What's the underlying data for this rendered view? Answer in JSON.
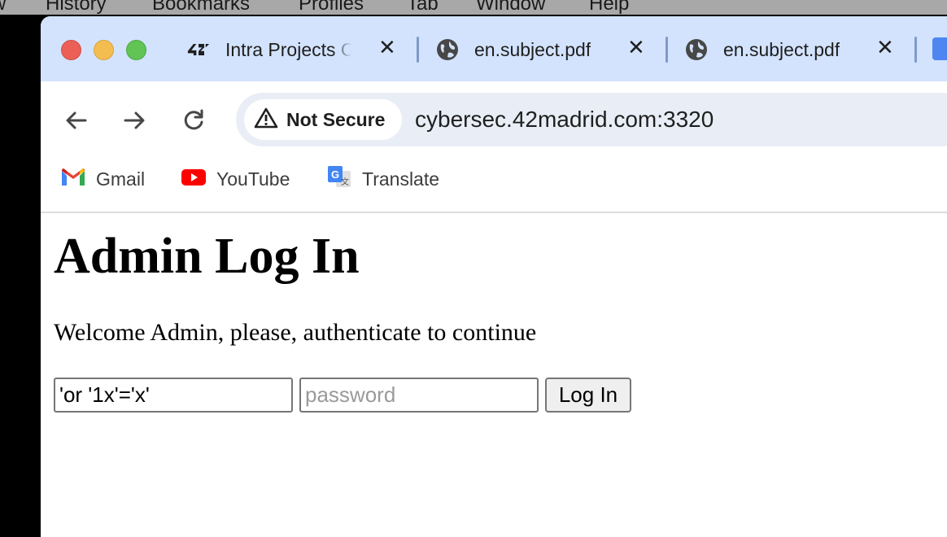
{
  "menubar": {
    "items": [
      "w",
      "History",
      "Bookmarks",
      "Profiles",
      "Tab",
      "Window",
      "Help"
    ]
  },
  "tabs": [
    {
      "title": "Intra Projects C",
      "icon": "42-logo-icon"
    },
    {
      "title": "en.subject.pdf",
      "icon": "globe-icon"
    },
    {
      "title": "en.subject.pdf",
      "icon": "globe-icon"
    }
  ],
  "toolbar": {
    "security_label": "Not Secure",
    "url": "cybersec.42madrid.com:3320"
  },
  "bookmarks": [
    {
      "label": "Gmail",
      "icon": "gmail-icon"
    },
    {
      "label": "YouTube",
      "icon": "youtube-icon"
    },
    {
      "label": "Translate",
      "icon": "translate-icon"
    }
  ],
  "page": {
    "heading": "Admin Log In",
    "welcome": "Welcome Admin, please, authenticate to continue",
    "username_value": "'or '1x'='x'",
    "password_placeholder": "password",
    "login_label": "Log In"
  },
  "colors": {
    "tabstrip": "#d3e3fd",
    "omnibox": "#e9eef6",
    "close_red": "#ec5f57",
    "minimize_yellow": "#f4bd4f",
    "maximize_green": "#61c454"
  }
}
